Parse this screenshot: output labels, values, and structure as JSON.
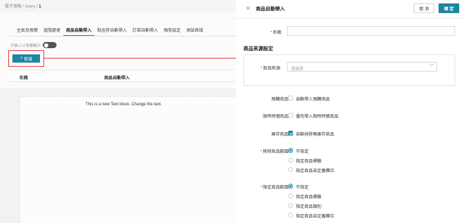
{
  "background": {
    "breadcrumb_parent": "電子領報 / Avery /",
    "breadcrumb_current": "1",
    "tabs": [
      "主頁及預覽",
      "進階變更",
      "商品自動帶入",
      "點金券自動帶入",
      "訂單自動帶入",
      "預卷設定",
      "測試區域"
    ],
    "active_tab_index": 2,
    "toggle_label": "手機上以堆疊顯示",
    "add_button_label": "新增",
    "table_headers": [
      "名稱",
      "商品自動帶入"
    ],
    "text_block": "This is a new Text block. Change the text."
  },
  "drawer": {
    "title": "商品自動帶入",
    "cancel_label": "取 消",
    "confirm_label": "確 定",
    "name_label": "名稱:",
    "name_value": "",
    "section_title": "商品來源設定",
    "source_label": "商品來源:",
    "source_placeholder": "請選擇",
    "presale_label": "預購商品:",
    "presale_option": "自動帶入預購商品",
    "presale_checked": false,
    "limited_label": "限時特價商品:",
    "limited_option": "優先帶入限時特價商品",
    "limited_checked": false,
    "stock_label": "庫存商品:",
    "stock_option": "自動排除無庫存商品",
    "stock_checked": true,
    "exclude_label": "排除商品範圍:",
    "exclude_options": [
      "不指定",
      "指定商品標籤",
      "指定商品自定義欄位"
    ],
    "exclude_selected": 0,
    "limit_label": "限定商品範圍:",
    "limit_options": [
      "不指定",
      "指定商品標籤",
      "指定商品類別",
      "指定商品自定義欄位"
    ],
    "limit_selected": 0
  },
  "colors": {
    "accent": "#1e86a0",
    "highlight": "#e8383d"
  }
}
